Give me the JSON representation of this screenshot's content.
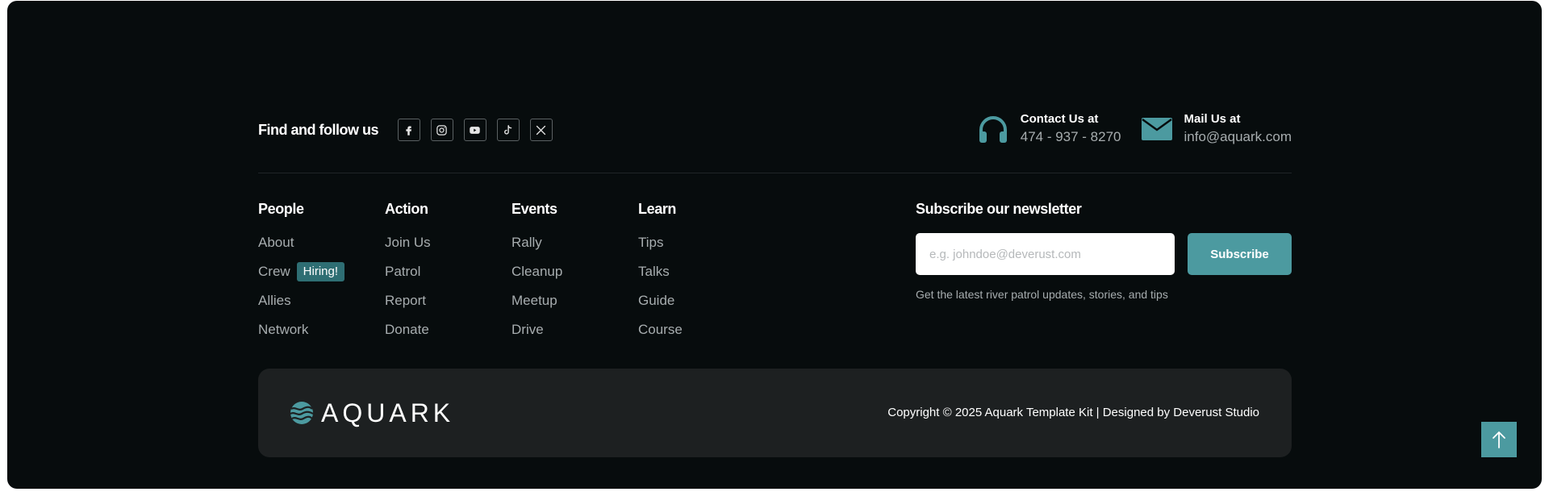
{
  "follow": {
    "label": "Find and follow us",
    "social": [
      "facebook-icon",
      "instagram-icon",
      "youtube-icon",
      "tiktok-icon",
      "x-twitter-icon"
    ]
  },
  "contacts": [
    {
      "icon": "headphones-icon",
      "title": "Contact Us at",
      "value": "474 - 937 - 8270"
    },
    {
      "icon": "envelope-icon",
      "title": "Mail Us at",
      "value": "info@aquark.com"
    }
  ],
  "columns": [
    {
      "heading": "People",
      "links": [
        "About",
        "Crew",
        "Allies",
        "Network"
      ],
      "badge": "Hiring!"
    },
    {
      "heading": "Action",
      "links": [
        "Join Us",
        "Patrol",
        "Report",
        "Donate"
      ]
    },
    {
      "heading": "Events",
      "links": [
        "Rally",
        "Cleanup",
        "Meetup",
        "Drive"
      ]
    },
    {
      "heading": "Learn",
      "links": [
        "Tips",
        "Talks",
        "Guide",
        "Course"
      ]
    }
  ],
  "newsletter": {
    "heading": "Subscribe our newsletter",
    "placeholder": "e.g. johndoe@deverust.com",
    "button": "Subscribe",
    "note": "Get the latest river patrol updates, stories, and tips"
  },
  "footer": {
    "logo_text": "AQUARK",
    "copyright": "Copyright © 2025 Aquark Template Kit | Designed by Deverust Studio"
  },
  "colors": {
    "accent": "#4c9aa0",
    "background": "#070c0d",
    "bar": "#1d2021",
    "badge": "#2e6e73"
  }
}
